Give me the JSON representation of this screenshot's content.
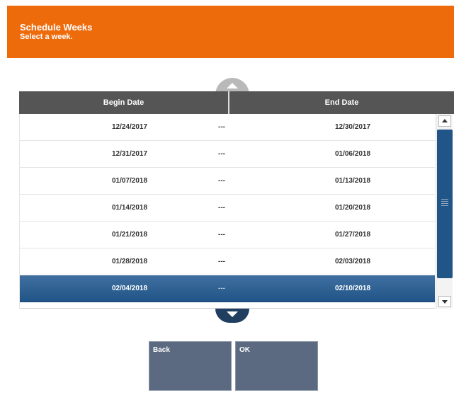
{
  "header": {
    "title": "Schedule Weeks",
    "subtitle": "Select a week."
  },
  "table": {
    "columns": {
      "begin": "Begin Date",
      "end": "End Date"
    },
    "rows": [
      {
        "begin": "12/24/2017",
        "sep": "---",
        "end": "12/30/2017",
        "selected": false
      },
      {
        "begin": "12/31/2017",
        "sep": "---",
        "end": "01/06/2018",
        "selected": false
      },
      {
        "begin": "01/07/2018",
        "sep": "---",
        "end": "01/13/2018",
        "selected": false
      },
      {
        "begin": "01/14/2018",
        "sep": "---",
        "end": "01/20/2018",
        "selected": false
      },
      {
        "begin": "01/21/2018",
        "sep": "---",
        "end": "01/27/2018",
        "selected": false
      },
      {
        "begin": "01/28/2018",
        "sep": "---",
        "end": "02/03/2018",
        "selected": false
      },
      {
        "begin": "02/04/2018",
        "sep": "---",
        "end": "02/10/2018",
        "selected": true
      }
    ]
  },
  "buttons": {
    "back": "Back",
    "ok": "OK"
  },
  "colors": {
    "header_bg": "#ee6b0c",
    "selected_row": "#215587",
    "table_header_bg": "#555555",
    "button_bg": "#5b6a80"
  },
  "icons": {
    "scroll_up": "chevron-up-icon",
    "scroll_down": "chevron-down-icon"
  }
}
